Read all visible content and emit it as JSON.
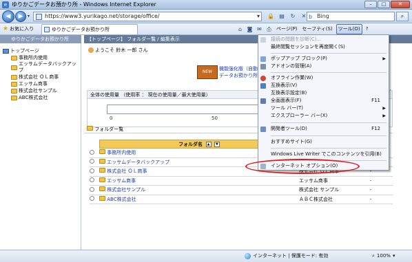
{
  "window": {
    "title": "ゆりかごデータお預かり所 - Windows Internet Explorer",
    "min": "–",
    "max": "□",
    "close": "✕"
  },
  "address": {
    "url": "https://www3.yurikago.net/storage/office/",
    "search_text": "Bing"
  },
  "favorites": {
    "label": "お気に入り",
    "tab_title": "ゆりかごデータお預かり所"
  },
  "commandbar": {
    "page": "ページ(P)",
    "safety": "セーフティ(S)",
    "tools": "ツール(O)",
    "help": "?"
  },
  "sidebar": {
    "header": "ゆりかごデータお預かり所",
    "root": "トップページ",
    "items": [
      {
        "label": "事務所内使用",
        "type": "folder"
      },
      {
        "label": "エッサムデータバックアップ",
        "type": "folder"
      },
      {
        "label": "株式会社 ＯＬ商事",
        "type": "folder"
      },
      {
        "label": "エッサム商事",
        "type": "folder"
      },
      {
        "label": "株式会社サンプル",
        "type": "folder"
      },
      {
        "label": "ABC株式会社",
        "type": "folder"
      }
    ]
  },
  "main": {
    "breadcrumb": "【トップページ】 フォルダー覧 / 編集表示",
    "welcome": "ようこそ 鈴木 一郎 さん",
    "banner_text1": "機能強化版（自動バックアップ",
    "banner_text2": "データお預かり所 ロー",
    "banner_badge": "NEW",
    "right_links": [
      "定",
      "設定"
    ],
    "usage_title": "全体の使用量 （使用率 ： 現在の使用量／最大使用量）",
    "usage_ticks": [
      "0",
      "50"
    ],
    "folder_header": "フォルダー覧",
    "table_header": "フォルダ名",
    "folders": [
      {
        "name": "事務所内使用",
        "owner": "",
        "dash": ""
      },
      {
        "name": "エッサムデータバックアップ",
        "owner": "",
        "dash": ""
      },
      {
        "name": "株式会社 ＯＬ商事",
        "owner": "株式会社 ＯＬ商事",
        "dash": "-"
      },
      {
        "name": "エッサム商事",
        "owner": "エッサム商事",
        "dash": "-"
      },
      {
        "name": "株式会社サンプル",
        "owner": "株式会社 サンプル",
        "dash": "-"
      },
      {
        "name": "ABC株式会社",
        "owner": "ＡＢＣ株式会社",
        "dash": "-"
      }
    ]
  },
  "tools_menu": [
    {
      "label": "接続の問題を診断(C)...",
      "disabled": true
    },
    {
      "label": "最終閲覧セッションを再度開く(S)"
    },
    {
      "label": "ポップアップ ブロック(P)",
      "submenu": true
    },
    {
      "label": "アドオンの管理(A)"
    },
    {
      "label": "オフライン作業(W)"
    },
    {
      "label": "互換表示(V)"
    },
    {
      "label": "互換表示設定(B)"
    },
    {
      "label": "全画面表示(F)",
      "accel": "F11"
    },
    {
      "label": "ツール バー(T)",
      "submenu": true
    },
    {
      "label": "エクスプローラー バー(X)",
      "submenu": true
    },
    {
      "label": "開発者ツール(D)",
      "accel": "F12"
    },
    {
      "label": "おすすめサイト(G)"
    },
    {
      "label": "Windows Live Writer でこのコンテンツを引用(B)"
    },
    {
      "label": "インターネット オプション(O)"
    }
  ],
  "status": {
    "zone": "インターネット | 保護モード: 有効",
    "zoom": "100%"
  },
  "colors": {
    "highlight_ring": "#e2171a",
    "menu_bg": "#f4f6fb",
    "table_header": "#f3c95a"
  }
}
